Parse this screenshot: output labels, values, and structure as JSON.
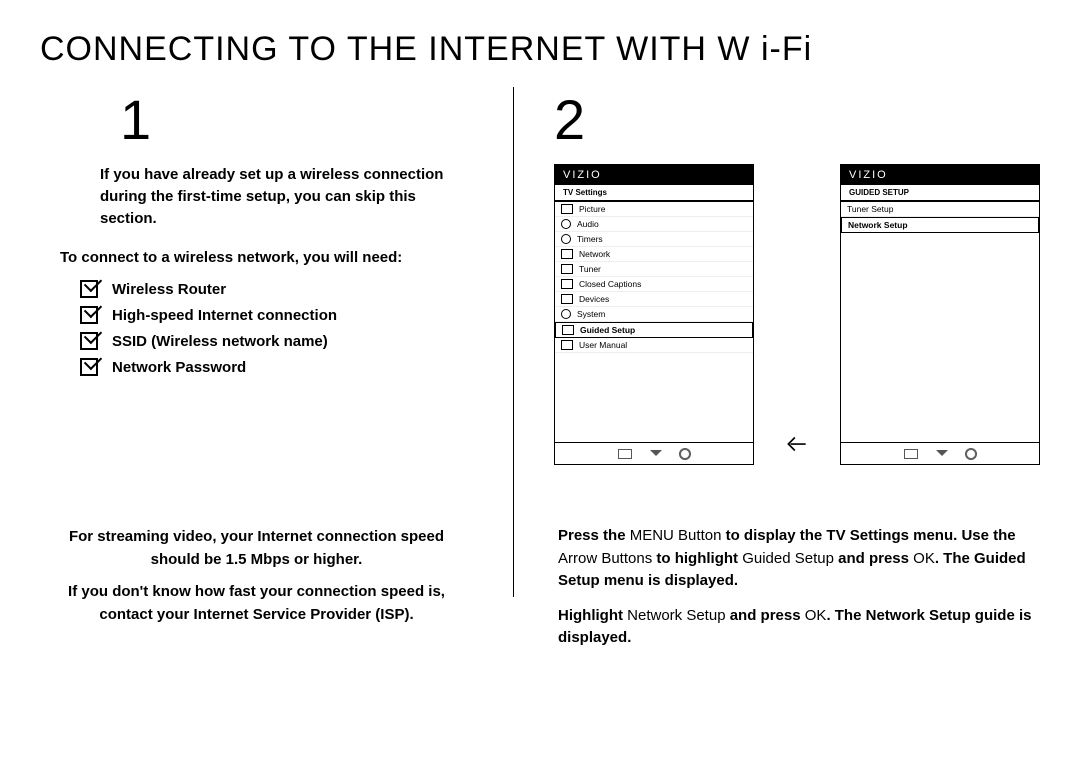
{
  "title": "CONNECTING TO THE INTERNET WITH W i-Fi",
  "step1": {
    "number": "1",
    "skip_note": "If you have already set up a wireless connection during the first-time setup, you can skip this section.",
    "need_intro": "To connect to a wireless network, you will need:",
    "checklist": [
      "Wireless Router",
      "High-speed Internet connection",
      "SSID (Wireless network name)",
      "Network Password"
    ],
    "footer_a": "For streaming video, your Internet connection speed should be 1.5 Mbps or higher.",
    "footer_b": "If you don't know how fast your connection speed is, contact your Internet Service Provider (ISP)."
  },
  "step2": {
    "number": "2",
    "screens": {
      "brand": "VIZIO",
      "menu1_head": "TV Settings",
      "menu1_items": [
        "Picture",
        "Audio",
        "Timers",
        "Network",
        "Tuner",
        "Closed Captions",
        "Devices",
        "System",
        "Guided Setup",
        "User Manual"
      ],
      "menu1_selected": "Guided Setup",
      "menu2_head": "GUIDED SETUP",
      "menu2_items": [
        "Tuner Setup",
        "Network Setup"
      ],
      "menu2_selected": "Network Setup"
    },
    "instr1_a": "Press the ",
    "instr1_b": "MENU Button",
    "instr1_c": " to display the TV Settings menu. Use the ",
    "instr1_d": "Arrow Buttons",
    "instr1_e": " to highlight ",
    "instr1_f": "Guided Setup",
    "instr1_g": " and press ",
    "instr1_h": "OK",
    "instr1_i": ". The Guided Setup menu is displayed.",
    "instr2_a": "Highlight ",
    "instr2_b": "Network Setup",
    "instr2_c": " and press ",
    "instr2_d": "OK",
    "instr2_e": ". The Network Setup guide is displayed."
  }
}
